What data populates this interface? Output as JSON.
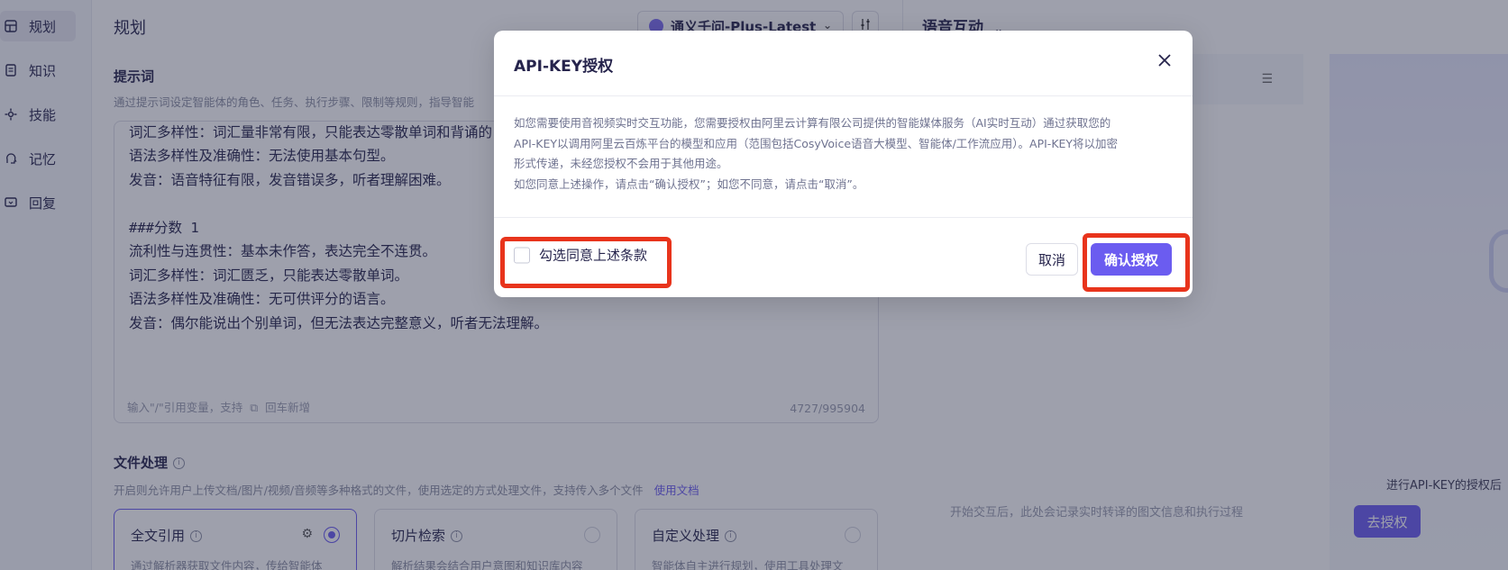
{
  "sidebar": {
    "items": [
      {
        "label": "规划",
        "icon": "grid-icon"
      },
      {
        "label": "知识",
        "icon": "document-icon"
      },
      {
        "label": "技能",
        "icon": "skill-icon"
      },
      {
        "label": "记忆",
        "icon": "brain-icon"
      },
      {
        "label": "回复",
        "icon": "reply-icon"
      }
    ]
  },
  "header": {
    "title": "规划",
    "model": "通义千问-Plus-Latest"
  },
  "prompt": {
    "label": "提示词",
    "desc": "通过提示词设定智能体的角色、任务、执行步骤、限制等规则，指导智能",
    "lines": [
      "词汇多样性：词汇量非常有限，只能表达零散单词和背诵的",
      "语法多样性及准确性：无法使用基本句型。",
      "发音：语音特征有限，发音错误多，听者理解困难。",
      "",
      "###分数 1",
      "流利性与连贯性：基本未作答，表达完全不连贯。",
      "词汇多样性：词汇匮乏，只能表达零散单词。",
      "语法多样性及准确性：无可供评分的语言。",
      "发音：偶尔能说出个别单词，但无法表达完整意义，听者无法理解。"
    ],
    "footer": "输入\"/\"引用变量，支持",
    "footer_after": "回车新增",
    "count": "4727/995904"
  },
  "file_processing": {
    "label": "文件处理",
    "desc": "开启则允许用户上传文档/图片/视频/音频等多种格式的文件，使用选定的方式处理文件，支持传入多个文件",
    "link": "使用文档",
    "options": [
      {
        "title": "全文引用",
        "desc": "通过解析器获取文件内容，传给智能体",
        "selected": true
      },
      {
        "title": "切片检索",
        "desc": "解析结果会结合用户意图和知识库内容",
        "selected": false
      },
      {
        "title": "自定义处理",
        "desc": "智能体自主进行规划，使用工具处理文",
        "selected": false
      }
    ]
  },
  "voice": {
    "title": "语音互动",
    "log_hint": "开始交互后，此处会记录实时转译的图文信息和执行过程",
    "stage_hint": "进行API-KEY的授权后",
    "stage_button": "去授权"
  },
  "modal": {
    "title": "API-KEY授权",
    "body": [
      "如您需要使用音视频实时交互功能，您需要授权由阿里云计算有限公司提供的智能媒体服务（AI实时互动）通过获取您的",
      "API-KEY以调用阿里云百炼平台的模型和应用（范围包括CosyVoice语音大模型、智能体/工作流应用）。API-KEY将以加密",
      "形式传递，未经您授权不会用于其他用途。",
      "如您同意上述操作，请点击“确认授权”；如您不同意，请点击“取消”。"
    ],
    "agree_label": "勾选同意上述条款",
    "cancel": "取消",
    "confirm": "确认授权"
  },
  "colors": {
    "accent": "#6b5cf0",
    "highlight": "#e8341c"
  }
}
